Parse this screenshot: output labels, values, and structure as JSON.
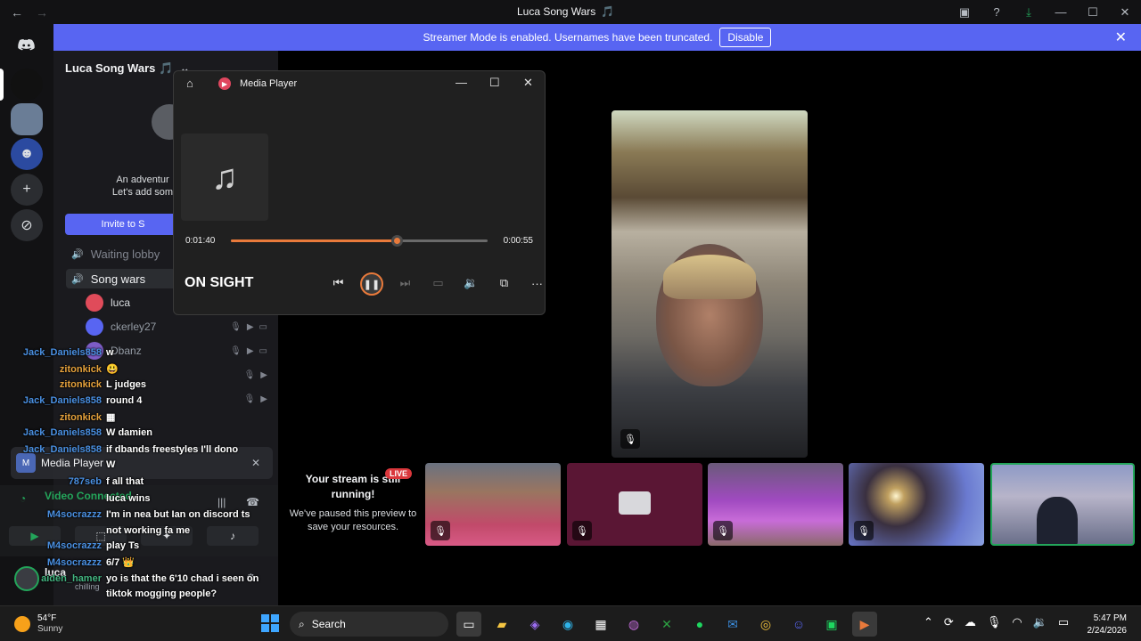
{
  "titlebar": {
    "back": "←",
    "forward": "→",
    "title": "Luca Song Wars",
    "title_emoji": "🎵",
    "icons": [
      "inbox-icon",
      "help-icon",
      "download-icon",
      "minimize-icon",
      "maximize-icon",
      "close-icon"
    ]
  },
  "banner": {
    "text": "Streamer Mode is enabled. Usernames have been truncated.",
    "button": "Disable",
    "close": "✕"
  },
  "guild": {
    "name": "Luca Song Wars",
    "emoji": "🎵",
    "invite_text_1": "An adventur",
    "invite_text_2": "Let's add som",
    "invite_button": "Invite to S"
  },
  "voice_channels": [
    {
      "name": "Waiting lobby",
      "active": false
    },
    {
      "name": "Song wars",
      "active": true
    }
  ],
  "members": [
    {
      "name": "luca",
      "color": "#e04b5a"
    },
    {
      "name": "ckerley27",
      "color": "#5865f2"
    },
    {
      "name": "Dbanz",
      "color": "#7d5cc6"
    }
  ],
  "chat": [
    {
      "user": "Jack_Daniels858",
      "user_class": "u-blue",
      "text": "w"
    },
    {
      "user": "zitonkick",
      "user_class": "u-gold",
      "text": "😃"
    },
    {
      "user": "zitonkick",
      "user_class": "u-gold",
      "text": "L judges"
    },
    {
      "user": "Jack_Daniels858",
      "user_class": "u-blue",
      "text": "round 4"
    },
    {
      "user": "zitonkick",
      "user_class": "u-gold",
      "text": "▦"
    },
    {
      "user": "Jack_Daniels858",
      "user_class": "u-blue",
      "text": "W damien"
    },
    {
      "user": "Jack_Daniels858",
      "user_class": "u-blue",
      "text": "if dbands freestyles I'll dono"
    },
    {
      "user": "",
      "user_class": "u-blue",
      "text": "W"
    },
    {
      "user": "787seb",
      "user_class": "u-blue",
      "text": "f all that"
    },
    {
      "user": "",
      "user_class": "u-blue",
      "text": "luca wins"
    },
    {
      "user": "M4socrazzz",
      "user_class": "u-blue",
      "text": "I'm in nea but Ian on discord ts"
    },
    {
      "user": "",
      "user_class": "u-blue",
      "text": "not working fa me"
    },
    {
      "user": "M4socrazzz",
      "user_class": "u-blue",
      "text": "play Ts"
    },
    {
      "user": "M4socrazzz",
      "user_class": "u-blue",
      "text": "6/7 👑"
    },
    {
      "user": "aiden_hamer",
      "user_class": "u-green",
      "text": "yo is that the 6'10 chad i seen on"
    },
    {
      "user": "",
      "user_class": "u-green",
      "text": "tiktok mogging people?"
    }
  ],
  "media_notice": {
    "label": "Media Player"
  },
  "voice_panel": {
    "status": "Video Connected"
  },
  "user_area": {
    "name": "luca",
    "status": "chilling"
  },
  "media_player": {
    "title": "Media Player",
    "elapsed": "0:01:40",
    "remaining": "0:00:55",
    "progress": 0.645,
    "song": "ON SIGHT",
    "accent": "#e97a3b"
  },
  "stream": {
    "live_badge": "LIVE",
    "heading": "Your stream is still running!",
    "body": "We've paused this preview to save your resources."
  },
  "tiles": [
    {
      "name": "participant-tile-1",
      "bg": "linear-gradient(180deg,#6a7280 0%,#9a7560 35%,#c14a6a 75%,#d85a86 100%)"
    },
    {
      "name": "participant-tile-2",
      "bg": "#5a1634"
    },
    {
      "name": "participant-tile-3",
      "bg": "linear-gradient(180deg,#6a5a7a 0%,#a04ac0 45%,#c86cd8 70%,#8a6a6a 100%)"
    },
    {
      "name": "participant-tile-4",
      "bg": "radial-gradient(circle at 35% 40%,#fff6d0 0%,#c0a060 8%,#3a3040 30%,#6a7ad0 70%,#8aa0e0 100%)"
    },
    {
      "name": "participant-tile-5",
      "bg": "linear-gradient(180deg,#8e9ac6 0%,#b7b4c9 40%,#6a6f8a 100%)"
    }
  ],
  "taskbar": {
    "temp": "54°F",
    "condition": "Sunny",
    "search": "Search",
    "time": "5:47 PM",
    "date": "2/24/2026"
  }
}
